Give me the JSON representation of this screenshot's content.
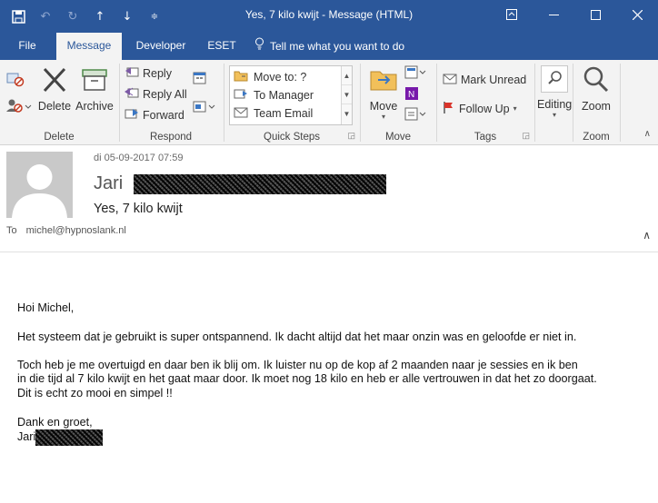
{
  "window": {
    "title": "Yes, 7 kilo kwijt  -  Message (HTML)"
  },
  "tabs": [
    {
      "label": "File"
    },
    {
      "label": "Message"
    },
    {
      "label": "Developer"
    },
    {
      "label": "ESET"
    },
    {
      "label": "Tell me what you want to do"
    }
  ],
  "ribbon": {
    "delete_group": {
      "label": "Delete",
      "delete": "Delete",
      "archive": "Archive"
    },
    "respond_group": {
      "label": "Respond",
      "reply": "Reply",
      "reply_all": "Reply All",
      "forward": "Forward"
    },
    "quick_steps": {
      "label": "Quick Steps",
      "items": [
        "Move to: ?",
        "To Manager",
        "Team Email"
      ]
    },
    "move_group": {
      "label": "Move",
      "move": "Move"
    },
    "tags_group": {
      "label": "Tags",
      "mark_unread": "Mark Unread",
      "follow_up": "Follow Up"
    },
    "editing": {
      "label": "Editing"
    },
    "zoom_group": {
      "label": "Zoom",
      "zoom": "Zoom"
    }
  },
  "header": {
    "date": "di 05-09-2017 07:59",
    "from_name": "Jari",
    "subject": "Yes, 7 kilo kwijt",
    "to_label": "To",
    "to_address": "michel@hypnoslank.nl"
  },
  "body": {
    "greeting": "Hoi Michel,",
    "line1": "Het systeem dat je gebruikt is super ontspannend. Ik dacht altijd dat het maar onzin was en geloofde er niet in.",
    "line2": "Toch heb je me overtuigd en daar ben ik blij om. Ik luister nu op de kop af 2 maanden naar je sessies en ik ben",
    "line3": "in die tijd al 7 kilo kwijt en het gaat maar door. Ik moet nog 18 kilo en heb er alle vertrouwen in dat het zo doorgaat.",
    "line4": "Dit is echt zo mooi en simpel !!",
    "closing": "Dank en groet,",
    "signature": "Jari"
  },
  "colors": {
    "titlebar": "#2b579a",
    "ribbon": "#f3f3f3",
    "accent": "#2b579a"
  }
}
